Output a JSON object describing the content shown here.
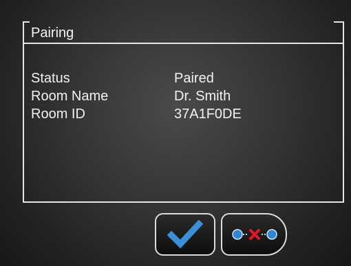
{
  "panel": {
    "title": "Pairing"
  },
  "info": {
    "rows": [
      {
        "label": "Status",
        "value": "Paired"
      },
      {
        "label": "Room Name",
        "value": "Dr. Smith"
      },
      {
        "label": "Room ID",
        "value": "37A1F0DE"
      }
    ]
  },
  "buttons": {
    "confirm_icon": "checkmark-icon",
    "unpair_icon": "unpair-icon"
  },
  "colors": {
    "check_blue": "#3b8fd6",
    "node_blue": "#2f86d1",
    "cross_red": "#e3162a",
    "border_light": "#e6e6e6"
  }
}
